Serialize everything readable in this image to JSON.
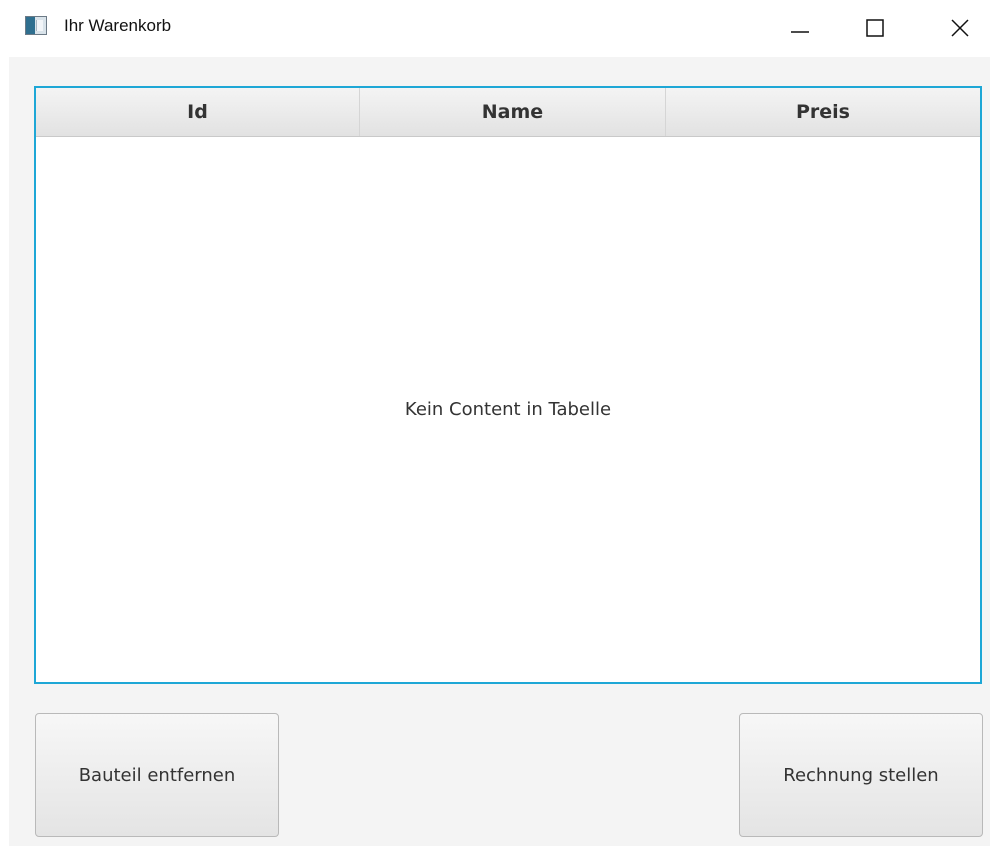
{
  "window": {
    "title": "Ihr Warenkorb",
    "icon": "app-window-icon",
    "controls": {
      "minimize_icon": "minimize-icon",
      "maximize_icon": "maximize-icon",
      "close_icon": "close-icon"
    }
  },
  "table": {
    "columns": [
      "Id",
      "Name",
      "Preis"
    ],
    "rows": [],
    "placeholder": "Kein Content in Tabelle",
    "focus_color": "#1ea7d6"
  },
  "actions": {
    "remove_label": "Bauteil entfernen",
    "invoice_label": "Rechnung stellen"
  }
}
